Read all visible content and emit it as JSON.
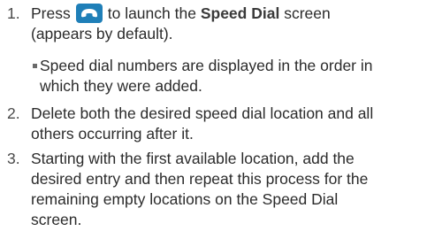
{
  "step1": {
    "number": "1.",
    "before_icon": "Press",
    "icon": "phone-call-icon",
    "after_icon": "to launch the",
    "bold": "Speed Dial",
    "after_bold": "screen",
    "line2": "(appears by default)."
  },
  "bullet": {
    "line1": "Speed dial numbers are displayed in the order in",
    "line2": "which they were added."
  },
  "step2": {
    "number": "2.",
    "line1": "Delete both the desired speed dial location and all",
    "line2": "others occurring after it."
  },
  "step3": {
    "number": "3.",
    "line1": "Starting with the first available location, add the",
    "line2": "desired entry and then repeat this process for the",
    "line3": "remaining empty locations on the Speed Dial",
    "line4": "screen."
  },
  "colors": {
    "icon_bg": "#1f7fb8",
    "text": "#2b2b2b"
  }
}
